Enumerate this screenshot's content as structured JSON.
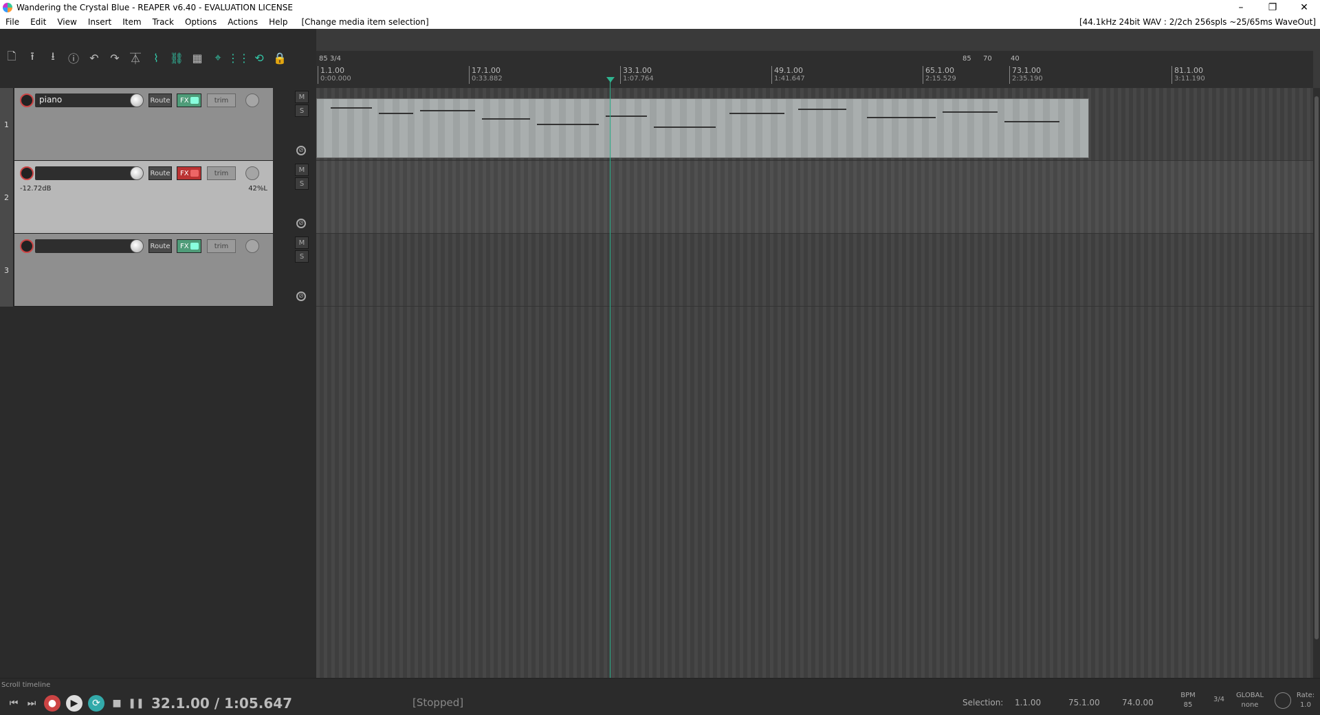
{
  "window": {
    "title": "Wandering the Crystal Blue - REAPER v6.40 - EVALUATION LICENSE",
    "min_glyph": "–",
    "max_glyph": "❐",
    "close_glyph": "✕"
  },
  "menu": {
    "items": [
      "File",
      "Edit",
      "View",
      "Insert",
      "Item",
      "Track",
      "Options",
      "Actions",
      "Help"
    ],
    "action_hint": "[Change media item selection]",
    "audio_status": "[44.1kHz 24bit WAV : 2/2ch 256spls ~25/65ms WaveOut]"
  },
  "toolbar": {
    "buttons": [
      {
        "name": "new-project-icon",
        "glyph": "🗋"
      },
      {
        "name": "open-project-icon",
        "glyph": "⭱"
      },
      {
        "name": "save-project-icon",
        "glyph": "⭳"
      },
      {
        "name": "project-info-icon",
        "glyph": "ⓘ"
      },
      {
        "name": "undo-icon",
        "glyph": "↶"
      },
      {
        "name": "redo-icon",
        "glyph": "↷"
      },
      {
        "name": "metronome-icon",
        "glyph": "⏄"
      },
      {
        "name": "ripple-edit-icon",
        "glyph": "⌇",
        "on": true
      },
      {
        "name": "link-icon",
        "glyph": "⛓",
        "on": true
      },
      {
        "name": "grid-icon",
        "glyph": "▦"
      },
      {
        "name": "snap-icon",
        "glyph": "⌖",
        "on": true
      },
      {
        "name": "grid-lines-icon",
        "glyph": "⋮⋮",
        "on": true
      },
      {
        "name": "loop-icon",
        "glyph": "⟲",
        "on": true
      },
      {
        "name": "lock-icon",
        "glyph": "🔒"
      }
    ]
  },
  "tracks": [
    {
      "number": "1",
      "name": "piano",
      "route": "Route",
      "fx": "FX",
      "trim": "trim",
      "volume": "",
      "pan": "",
      "mute": "M",
      "solo": "S",
      "selected": false,
      "fx_bypassed": false
    },
    {
      "number": "2",
      "name": "",
      "route": "Route",
      "fx": "FX",
      "trim": "trim",
      "volume": "-12.72dB",
      "pan": "42%L",
      "mute": "M",
      "solo": "S",
      "selected": true,
      "fx_bypassed": true
    },
    {
      "number": "3",
      "name": "",
      "route": "Route",
      "fx": "FX",
      "trim": "trim",
      "volume": "",
      "pan": "",
      "mute": "M",
      "solo": "S",
      "selected": false,
      "fx_bypassed": false
    }
  ],
  "ruler": {
    "tempo_start": "85 3/4",
    "markers": [
      {
        "measure": "1.1.00",
        "time": "0:00.000"
      },
      {
        "measure": "17.1.00",
        "time": "0:33.882"
      },
      {
        "measure": "33.1.00",
        "time": "1:07.764"
      },
      {
        "measure": "49.1.00",
        "time": "1:41.647"
      },
      {
        "measure": "65.1.00",
        "time": "2:15.529"
      },
      {
        "measure": "73.1.00",
        "time": "2:35.190"
      },
      {
        "measure": "81.1.00",
        "time": "3:11.190"
      }
    ],
    "tempo_changes": [
      "85",
      "70",
      "40"
    ]
  },
  "transport": {
    "scroll_label": "Scroll timeline",
    "position": "32.1.00 / 1:05.647",
    "state": "[Stopped]",
    "selection_label": "Selection:",
    "selection_start": "1.1.00",
    "selection_end": "75.1.00",
    "selection_length": "74.0.00",
    "bpm_label": "BPM",
    "bpm": "85",
    "time_sig": "3/4",
    "global_label": "GLOBAL",
    "global_value": "none",
    "rate_label": "Rate:",
    "rate": "1.0"
  }
}
